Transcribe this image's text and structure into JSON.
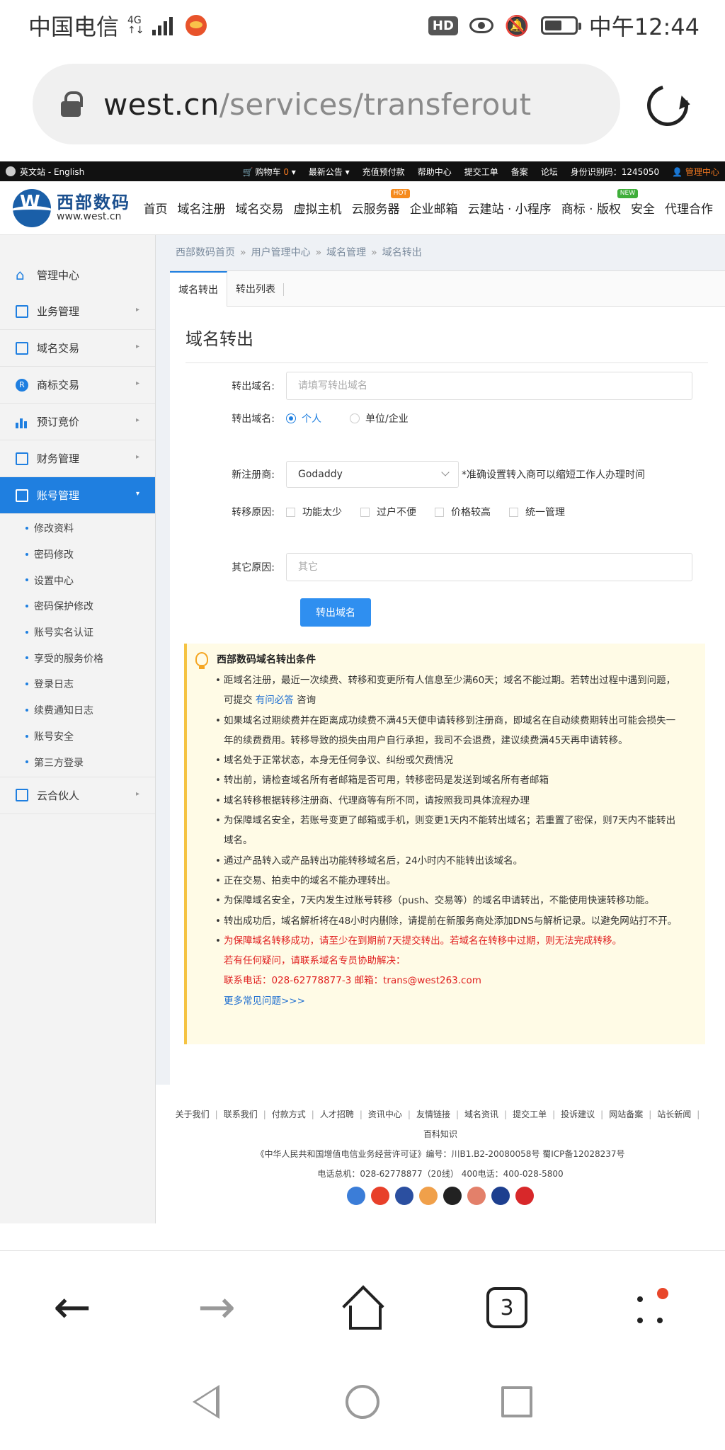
{
  "statusbar": {
    "carrier": "中国电信",
    "net": "4G",
    "net_sub": "↑↓",
    "hd": "HD",
    "time": "中午12:44"
  },
  "browser": {
    "url_host": "west.cn",
    "url_path": "/services/transferout",
    "tab_count": "3"
  },
  "sitebar": {
    "lang": "英文站 - English",
    "cart_label": "购物车",
    "cart_count": "0",
    "notice": "最新公告 ▾",
    "recharge": "充值预付款",
    "help": "帮助中心",
    "ticket": "提交工单",
    "beian": "备案",
    "forum": "论坛",
    "id_label": "身份识别码：1245050",
    "admin": "管理中心"
  },
  "header": {
    "logo_cn": "西部数码",
    "logo_en": "www.west.cn",
    "nav": [
      "首页",
      "域名注册",
      "域名交易",
      "虚拟主机",
      "云服务器",
      "企业邮箱",
      "云建站 · 小程序",
      "商标 · 版权",
      "安全",
      "代理合作"
    ],
    "hot": "HOT",
    "new": "NEW"
  },
  "sidebar": {
    "home": "管理中心",
    "items": [
      "业务管理",
      "域名交易",
      "商标交易",
      "预订竞价",
      "财务管理"
    ],
    "active": "账号管理",
    "subitems": [
      "修改资料",
      "密码修改",
      "设置中心",
      "密码保护修改",
      "账号实名认证",
      "享受的服务价格",
      "登录日志",
      "续费通知日志",
      "账号安全",
      "第三方登录"
    ],
    "last": "云合伙人",
    "r_icon": "R"
  },
  "breadcrumb": [
    "西部数码首页",
    "用户管理中心",
    "域名管理",
    "域名转出"
  ],
  "tabs": [
    "域名转出",
    "转出列表"
  ],
  "form": {
    "title": "域名转出",
    "domain_label": "转出域名:",
    "domain_placeholder": "请填写转出域名",
    "type_label": "转出域名:",
    "type_personal": "个人",
    "type_company": "单位/企业",
    "registrar_label": "新注册商:",
    "registrar_value": "Godaddy",
    "registrar_hint": "*准确设置转入商可以缩短工作人办理时间",
    "reason_label": "转移原因:",
    "reasons": [
      "功能太少",
      "过户不便",
      "价格较高",
      "统一管理"
    ],
    "other_label": "其它原因:",
    "other_placeholder": "其它",
    "submit": "转出域名"
  },
  "notice": {
    "title": "西部数码域名转出条件",
    "item1_a": "距域名注册，最近一次续费、转移和变更所有人信息至少满60天；域名不能过期。若转出过程中遇到问题，可提交",
    "item1_link": "有问必答",
    "item1_b": "咨询",
    "items": [
      "如果域名过期续费并在距离成功续费不满45天便申请转移到注册商，即域名在自动续费期转出可能会损失一年的续费费用。转移导致的损失由用户自行承担，我司不会退费，建议续费满45天再申请转移。",
      "域名处于正常状态，本身无任何争议、纠纷或欠费情况",
      "转出前，请检查域名所有者邮箱是否可用，转移密码是发送到域名所有者邮箱",
      "域名转移根据转移注册商、代理商等有所不同，请按照我司具体流程办理",
      "为保障域名安全，若账号变更了邮箱或手机，则变更1天内不能转出域名；若重置了密保，则7天内不能转出域名。",
      "通过产品转入或产品转出功能转移域名后，24小时内不能转出该域名。",
      "正在交易、拍卖中的域名不能办理转出。",
      "为保障域名安全，7天内发生过账号转移（push、交易等）的域名申请转出，不能使用快速转移功能。",
      "转出成功后，域名解析将在48小时内删除，请提前在新服务商处添加DNS与解析记录。以避免网站打不开。"
    ],
    "red_item": "为保障域名转移成功，请至少在到期前7天提交转出。若域名在转移中过期，则无法完成转移。",
    "red_line1": "若有任何疑问，请联系域名专员协助解决：",
    "red_line2": "联系电话：028-62778877-3 邮箱：trans@west263.com",
    "more": "更多常见问题>>>"
  },
  "footer": {
    "links": [
      "关于我们",
      "联系我们",
      "付款方式",
      "人才招聘",
      "资讯中心",
      "友情链接",
      "域名资讯",
      "提交工单",
      "投诉建议",
      "网站备案",
      "站长新闻",
      "百科知识"
    ],
    "license": "《中华人民共和国增值电信业务经营许可证》编号：川B1.B2-20080058号 蜀ICP备12028237号",
    "phone": "电话总机：028-62778877（20线）     400电话：400-028-5800"
  },
  "colors": {
    "accent": "#1f7fe0",
    "orange": "#f47920",
    "notice_bg": "#fffbe6",
    "red": "#e02020"
  }
}
